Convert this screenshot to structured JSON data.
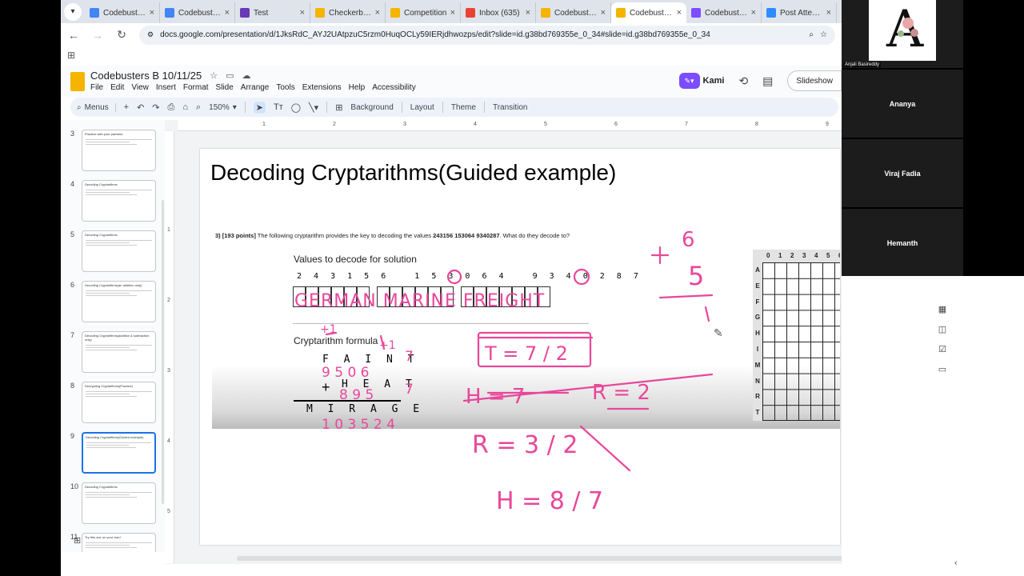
{
  "browser": {
    "tabs": [
      {
        "title": "Codebusters",
        "favicon_color": "#4285f4",
        "active": false
      },
      {
        "title": "Codebusters",
        "favicon_color": "#4285f4",
        "active": false
      },
      {
        "title": "Test",
        "favicon_color": "#673ab7",
        "active": false
      },
      {
        "title": "Checkerboar",
        "favicon_color": "#f4b400",
        "active": false
      },
      {
        "title": "Competition",
        "favicon_color": "#f4b400",
        "active": false
      },
      {
        "title": "Inbox (635)",
        "favicon_color": "#ea4335",
        "active": false
      },
      {
        "title": "Codebusters",
        "favicon_color": "#f4b400",
        "active": false
      },
      {
        "title": "Codebusters",
        "favicon_color": "#f4b400",
        "active": true
      },
      {
        "title": "Codebusters",
        "favicon_color": "#7c4dff",
        "active": false
      },
      {
        "title": "Post Attende",
        "favicon_color": "#2d8cff",
        "active": false
      }
    ],
    "url": "docs.google.com/presentation/d/1JksRdC_AYJ2UAtpzuC5rzm0HuqOCLy59IERjdhwozps/edit?slide=id.g38bd769355e_0_34#slide=id.g38bd769355e_0_34"
  },
  "docs": {
    "title": "Codebusters B 10/11/25",
    "menu": [
      "File",
      "Edit",
      "View",
      "Insert",
      "Format",
      "Slide",
      "Arrange",
      "Tools",
      "Extensions",
      "Help",
      "Accessibility"
    ],
    "kami_label": "Kami",
    "slideshow_label": "Slideshow",
    "toolbar": {
      "menus_label": "Menus",
      "zoom": "150%",
      "background": "Background",
      "layout": "Layout",
      "theme": "Theme",
      "transition": "Transition"
    },
    "ruler_h": [
      "1",
      "2",
      "3",
      "4",
      "5",
      "6",
      "7",
      "8",
      "9"
    ],
    "ruler_v": [
      "1",
      "2",
      "3",
      "4",
      "5"
    ]
  },
  "filmstrip": [
    {
      "num": "3",
      "title": "Practice with your partners",
      "selected": false
    },
    {
      "num": "4",
      "title": "Decoding Cryptarithms",
      "selected": false
    },
    {
      "num": "5",
      "title": "Decoding Cryptarithms",
      "selected": false
    },
    {
      "num": "6",
      "title": "Decoding Cryptarithms(an addition only)",
      "selected": false
    },
    {
      "num": "7",
      "title": "Decoding Cryptarithms(addition & subtraction only)",
      "selected": false
    },
    {
      "num": "8",
      "title": "Decrypting Cryptarithms(Practice)",
      "selected": false
    },
    {
      "num": "9",
      "title": "Decoding Cryptarithms(Guided example)",
      "selected": true
    },
    {
      "num": "10",
      "title": "Decoding Cryptarithms",
      "selected": false
    },
    {
      "num": "11",
      "title": "Try this one on your own!",
      "selected": false
    }
  ],
  "slide": {
    "title": "Decoding Cryptarithms(Guided example)",
    "question_num": "3) [193 points]",
    "question": "The following cryptarithm provides the key to decoding the values",
    "question_values": "243156  153064  9340287",
    "question_end": ". What do they decode to?",
    "values_label": "Values to decode for solution",
    "digits": "2 4 3 1 5 6   1 5 3 0 6 4   9 3 4 0 2 8 7",
    "formula_label": "Cryptarithm formula",
    "eq_top": "F A I N T",
    "eq_plus": "+",
    "eq_mid": "H E A T",
    "eq_result": "M I R A G E",
    "grid_cols": [
      "0",
      "1",
      "2",
      "3",
      "4",
      "5",
      "6"
    ],
    "grid_rows": [
      "A",
      "E",
      "F",
      "G",
      "H",
      "I",
      "M",
      "N",
      "R",
      "T"
    ],
    "handwriting": {
      "answer": "GERMAN MARINE FREIGHT",
      "faint_digits": "9 5 0 6",
      "heat_digits": "8 9 5",
      "mirage_digits": "1 0 3 5 2 4",
      "note_1": "T = 7 / 2",
      "note_2": "H = 7",
      "note_3": "R = 2",
      "note_4": "R = 3 / 2",
      "note_5": "H = 8 / 7",
      "sum_top": "6",
      "sum_mid": "5",
      "ink_color": "#e8479a"
    }
  },
  "video": {
    "self_label": "Anjali Basireddy",
    "participants": [
      "Ananya",
      "Viraj Fadia",
      "Hemanth"
    ]
  }
}
